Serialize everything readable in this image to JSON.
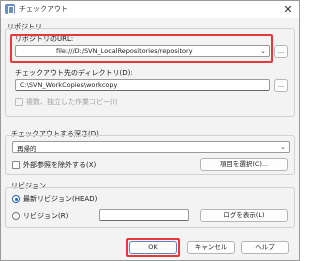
{
  "window": {
    "title": "チェックアウト",
    "close": "✕"
  },
  "repository": {
    "group_label": "リポジトリ",
    "url_label": "リポジトリのURL:",
    "url_value": "file:///D:/SVN_LocalRepositories/repository",
    "browse_label": "...",
    "dest_label": "チェックアウト先のディレクトリ(D):",
    "dest_value": "C:\\SVN_WorkCopies\\workcopy",
    "independent_label": "複数、独立した作業コピー(I)"
  },
  "depth": {
    "group_label": "チェックアウトする深さ(D)",
    "depth_value": "再帰的",
    "omit_externals_label": "外部参照を除外する(X)",
    "choose_items_label": "項目を選択(C)..."
  },
  "revision": {
    "group_label": "リビジョン",
    "head_label": "最新リビジョン(HEAD)",
    "specific_label": "リビジョン(R)",
    "revision_value": "",
    "show_log_label": "ログを表示(L)"
  },
  "footer": {
    "ok_label": "OK",
    "cancel_label": "キャンセル",
    "help_label": "ヘルプ"
  },
  "colors": {
    "highlight": "#e53a3a",
    "accent": "#2561b5"
  },
  "icons": {
    "app": "checkout-app-icon",
    "dropdown": "chevron-down-icon",
    "close": "close-icon"
  }
}
